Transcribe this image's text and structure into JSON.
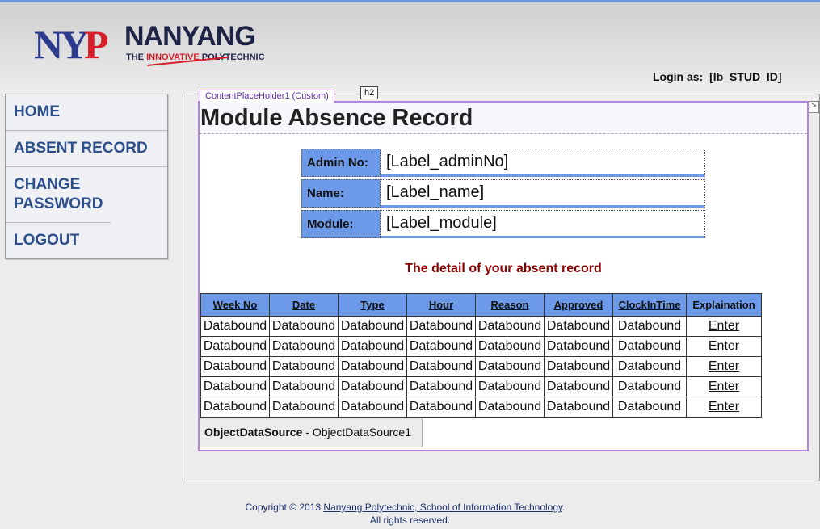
{
  "brand": {
    "logo_mark": "NYP",
    "name": "NANYANG",
    "tagline_prefix": "THE ",
    "tagline_accent": "INNOVATIVE",
    "tagline_suffix": " POLYTECHNIC",
    "colors": {
      "navy": "#2b3a8c",
      "red": "#d71f2b"
    }
  },
  "login": {
    "prefix": "Login as:",
    "user": "[lb_STUD_ID]"
  },
  "sidebar": {
    "items": [
      {
        "label": "HOME"
      },
      {
        "label": "ABSENT RECORD"
      },
      {
        "label": "CHANGE PASSWORD"
      },
      {
        "label": "LOGOUT"
      }
    ]
  },
  "designer": {
    "placeholder_tag": "ContentPlaceHolder1 (Custom)",
    "h2_tag": "h2",
    "arrow": ">"
  },
  "page": {
    "title": "Module Absence Record"
  },
  "info": {
    "admin_label": "Admin No:",
    "admin_value": "[Label_adminNo]",
    "name_label": "Name:",
    "name_value": "[Label_name]",
    "module_label": "Module:",
    "module_value": "[Label_module]"
  },
  "detail_heading": "The detail of your absent record",
  "grid": {
    "headers": [
      "Week No",
      "Date",
      "Type",
      "Hour",
      "Reason",
      "Approved",
      "ClockInTime",
      "Explaination"
    ],
    "rows": [
      [
        "Databound",
        "Databound",
        "Databound",
        "Databound",
        "Databound",
        "Databound",
        "Databound",
        "Enter"
      ],
      [
        "Databound",
        "Databound",
        "Databound",
        "Databound",
        "Databound",
        "Databound",
        "Databound",
        "Enter"
      ],
      [
        "Databound",
        "Databound",
        "Databound",
        "Databound",
        "Databound",
        "Databound",
        "Databound",
        "Enter"
      ],
      [
        "Databound",
        "Databound",
        "Databound",
        "Databound",
        "Databound",
        "Databound",
        "Databound",
        "Enter"
      ],
      [
        "Databound",
        "Databound",
        "Databound",
        "Databound",
        "Databound",
        "Databound",
        "Databound",
        "Enter"
      ]
    ]
  },
  "ods": {
    "type": "ObjectDataSource",
    "separator": " - ",
    "name": "ObjectDataSource1"
  },
  "footer": {
    "copyright_prefix": "Copyright © 2013 ",
    "link_text": "Nanyang Polytechnic, School of Information Technology",
    "suffix": ".",
    "line2": "All rights reserved."
  }
}
